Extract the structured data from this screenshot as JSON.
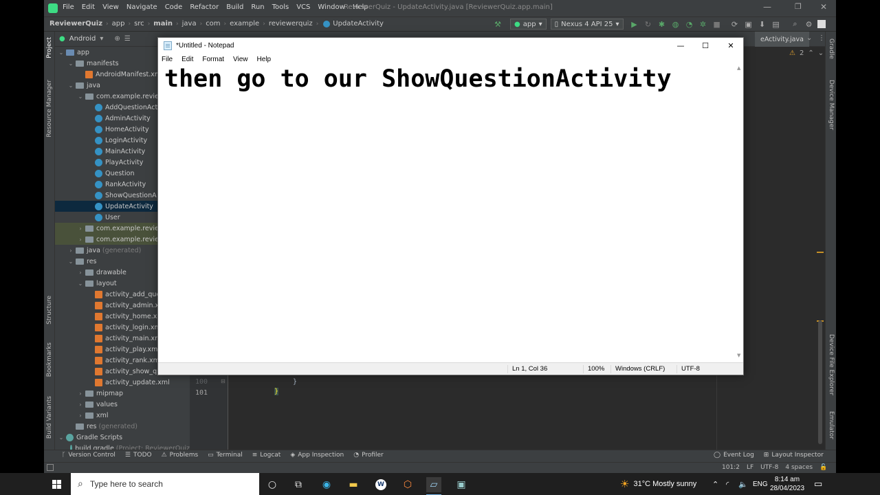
{
  "ide": {
    "menu": [
      "File",
      "Edit",
      "View",
      "Navigate",
      "Code",
      "Refactor",
      "Build",
      "Run",
      "Tools",
      "VCS",
      "Window",
      "Help"
    ],
    "title": "ReviewerQuiz - UpdateActivity.java [ReviewerQuiz.app.main]",
    "breadcrumbs": [
      "ReviewerQuiz",
      "app",
      "src",
      "main",
      "java",
      "com",
      "example",
      "reviewerquiz",
      "UpdateActivity"
    ],
    "run_config": "app",
    "device": "Nexus 4 API 25",
    "project_view": "Android",
    "editor_tab": "eActivity.java",
    "warning_count": "2",
    "left_tabs": [
      "Project",
      "Resource Manager",
      "Structure",
      "Bookmarks",
      "Build Variants"
    ],
    "right_tabs": [
      "Gradle",
      "Device Manager",
      "Device File Explorer",
      "Emulator"
    ],
    "tree": [
      {
        "label": "app",
        "depth": 0,
        "icon": "folder-blue",
        "open": true
      },
      {
        "label": "manifests",
        "depth": 1,
        "icon": "folder",
        "open": true
      },
      {
        "label": "AndroidManifest.xml",
        "depth": 2,
        "icon": "xml"
      },
      {
        "label": "java",
        "depth": 1,
        "icon": "folder",
        "open": true
      },
      {
        "label": "com.example.review",
        "depth": 2,
        "icon": "folder",
        "open": true
      },
      {
        "label": "AddQuestionAct",
        "depth": 3,
        "icon": "class"
      },
      {
        "label": "AdminActivity",
        "depth": 3,
        "icon": "class"
      },
      {
        "label": "HomeActivity",
        "depth": 3,
        "icon": "class"
      },
      {
        "label": "LoginActivity",
        "depth": 3,
        "icon": "class"
      },
      {
        "label": "MainActivity",
        "depth": 3,
        "icon": "class"
      },
      {
        "label": "PlayActivity",
        "depth": 3,
        "icon": "class"
      },
      {
        "label": "Question",
        "depth": 3,
        "icon": "class"
      },
      {
        "label": "RankActivity",
        "depth": 3,
        "icon": "class"
      },
      {
        "label": "ShowQuestionA",
        "depth": 3,
        "icon": "class"
      },
      {
        "label": "UpdateActivity",
        "depth": 3,
        "icon": "class",
        "selected": true
      },
      {
        "label": "User",
        "depth": 3,
        "icon": "class"
      },
      {
        "label": "com.example.review",
        "depth": 2,
        "icon": "folder",
        "closed": true,
        "modified": true
      },
      {
        "label": "com.example.review",
        "depth": 2,
        "icon": "folder",
        "closed": true,
        "modified": true
      },
      {
        "label": "java",
        "suffix": "(generated)",
        "depth": 1,
        "icon": "folder",
        "closed": true
      },
      {
        "label": "res",
        "depth": 1,
        "icon": "folder",
        "open": true
      },
      {
        "label": "drawable",
        "depth": 2,
        "icon": "folder",
        "closed": true
      },
      {
        "label": "layout",
        "depth": 2,
        "icon": "folder",
        "open": true
      },
      {
        "label": "activity_add_que",
        "depth": 3,
        "icon": "xml"
      },
      {
        "label": "activity_admin.x",
        "depth": 3,
        "icon": "xml"
      },
      {
        "label": "activity_home.x",
        "depth": 3,
        "icon": "xml"
      },
      {
        "label": "activity_login.xm",
        "depth": 3,
        "icon": "xml"
      },
      {
        "label": "activity_main.xm",
        "depth": 3,
        "icon": "xml"
      },
      {
        "label": "activity_play.xml",
        "depth": 3,
        "icon": "xml"
      },
      {
        "label": "activity_rank.xm",
        "depth": 3,
        "icon": "xml"
      },
      {
        "label": "activity_show_qu",
        "depth": 3,
        "icon": "xml"
      },
      {
        "label": "activity_update.xml",
        "depth": 3,
        "icon": "xml"
      },
      {
        "label": "mipmap",
        "depth": 2,
        "icon": "folder",
        "closed": true
      },
      {
        "label": "values",
        "depth": 2,
        "icon": "folder",
        "closed": true
      },
      {
        "label": "xml",
        "depth": 2,
        "icon": "folder",
        "closed": true
      },
      {
        "label": "res",
        "suffix": "(generated)",
        "depth": 1,
        "icon": "folder"
      },
      {
        "label": "Gradle Scripts",
        "depth": 0,
        "icon": "gradle",
        "open": true
      },
      {
        "label": "build.gradle",
        "suffix": "(Project: ReviewerQuiz",
        "depth": 1,
        "icon": "gradle"
      }
    ],
    "code_lines": [
      {
        "num": "100",
        "text": "}"
      },
      {
        "num": "101",
        "text": "}"
      }
    ],
    "bottom_tools": [
      "Version Control",
      "TODO",
      "Problems",
      "Terminal",
      "Logcat",
      "App Inspection",
      "Profiler"
    ],
    "bottom_tools_right": [
      "Event Log",
      "Layout Inspector"
    ],
    "status": {
      "position": "101:2",
      "line_sep": "LF",
      "encoding": "UTF-8",
      "indent": "4 spaces"
    }
  },
  "notepad": {
    "title": "*Untitled - Notepad",
    "menu": [
      "File",
      "Edit",
      "Format",
      "View",
      "Help"
    ],
    "content": "then go to our ShowQuestionActivity",
    "status": {
      "position": "Ln 1, Col 36",
      "zoom": "100%",
      "line_endings": "Windows (CRLF)",
      "encoding": "UTF-8"
    }
  },
  "taskbar": {
    "search_placeholder": "Type here to search",
    "weather": "31°C  Mostly sunny",
    "language": "ENG",
    "time": "8:14 am",
    "date": "28/04/2023"
  },
  "colors": {
    "ide_bg": "#2b2b2b",
    "ide_chrome": "#3c3f41",
    "selection": "#0d293e",
    "taskbar": "#1f1f1f"
  }
}
